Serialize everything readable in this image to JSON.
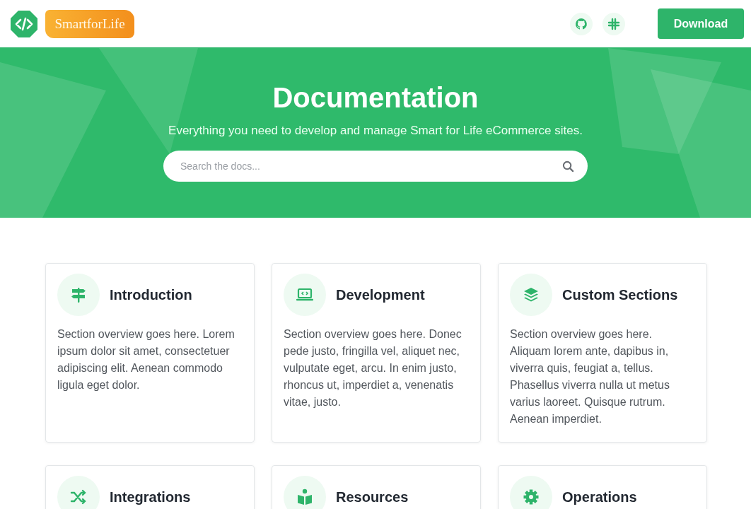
{
  "header": {
    "logo_text": "SmartforLife",
    "download_button": "Download"
  },
  "hero": {
    "title": "Documentation",
    "subtitle": "Everything you need to develop and manage Smart for Life eCommerce sites.",
    "search": {
      "placeholder": "Search the docs..."
    }
  },
  "sections": [
    {
      "kind": "signpost",
      "title": "Introduction",
      "text": "Section overview goes here. Lorem ipsum dolor sit amet, consectetuer adipiscing elit. Aenean commodo ligula eget dolor."
    },
    {
      "kind": "laptop",
      "title": "Development",
      "text": "Section overview goes here. Donec pede justo, fringilla vel, aliquet nec, vulputate eget, arcu. In enim justo, rhoncus ut, imperdiet a, venenatis vitae, justo."
    },
    {
      "kind": "layers",
      "title": "Custom Sections",
      "text": "Section overview goes here. Aliquam lorem ante, dapibus in, viverra quis, feugiat a, tellus. Phasellus viverra nulla ut metus varius laoreet. Quisque rutrum. Aenean imperdiet."
    },
    {
      "kind": "shuffle",
      "title": "Integrations"
    },
    {
      "kind": "reader",
      "title": "Resources"
    },
    {
      "kind": "gear",
      "title": "Operations"
    }
  ]
}
